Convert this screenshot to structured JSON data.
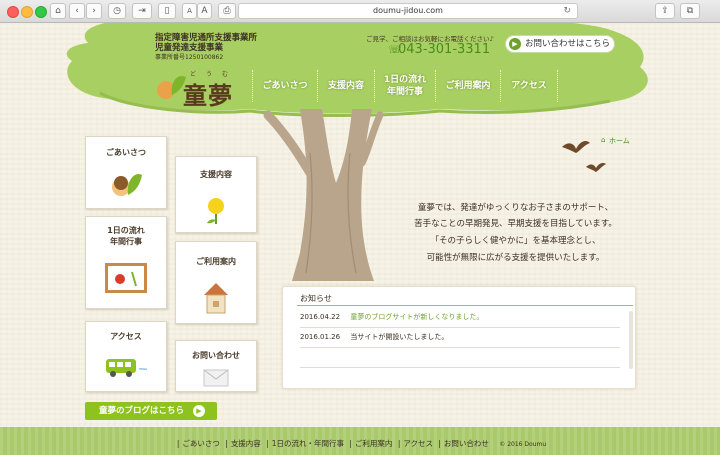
{
  "browser": {
    "url": "doumu-jidou.com",
    "buttons": {
      "home": "⌂",
      "back": "‹",
      "forward": "›",
      "history": "◷",
      "share_tab": "⇥",
      "sidebar": "▯",
      "font_small": "A",
      "font_large": "A",
      "print": "⎙",
      "share": "⇪",
      "tabs": "⧉",
      "reload": "↻"
    }
  },
  "header": {
    "line1": "指定障害児通所支援事業所",
    "line2": "児童発達支援事業",
    "line3": "事業所番号1250100862",
    "logo": "童夢",
    "logo_ruby": "どうむ",
    "tagline": "ご見学、ご相談はお気軽にお電話ください♪",
    "phone": "043-301-3311",
    "contact_button": "お問い合わせはこちら"
  },
  "nav": [
    {
      "label": "ごあいさつ"
    },
    {
      "label": "支援内容"
    },
    {
      "label": "1日の流れ\n年間行事"
    },
    {
      "label": "ご利用案内"
    },
    {
      "label": "アクセス"
    }
  ],
  "boxes": {
    "greeting": "ごあいさつ",
    "support": "支援内容",
    "daily_flow": "1日の流れ\n年間行事",
    "guide": "ご利用案内",
    "access": "アクセス",
    "inquiry": "お問い合わせ"
  },
  "blog_button": "童夢のブログはこちら",
  "breadcrumb": {
    "home": "ホーム"
  },
  "intro": [
    "童夢では、発達がゆっくりなお子さまのサポート、",
    "苦手なことの早期発見、早期支援を目指しています。",
    "「その子らしく健やかに」を基本理念とし、",
    "可能性が無限に広がる支援を提供いたします。"
  ],
  "news": {
    "title": "お知らせ",
    "items": [
      {
        "date": "2016.04.22",
        "text": "童夢のブログサイトが新しくなりました。",
        "link": true
      },
      {
        "date": "2016.01.26",
        "text": "当サイトが開設いたしました。",
        "link": false
      }
    ]
  },
  "footer": {
    "links": [
      "ごあいさつ",
      "支援内容",
      "1日の流れ・年間行事",
      "ご利用案内",
      "アクセス",
      "お問い合わせ"
    ],
    "copyright": "© 2016 Doumu"
  },
  "colors": {
    "accent_green": "#8dc21f",
    "brown_text": "#3d2f22",
    "link_green": "#6aa22a",
    "tree_green": "#a8cf62"
  }
}
